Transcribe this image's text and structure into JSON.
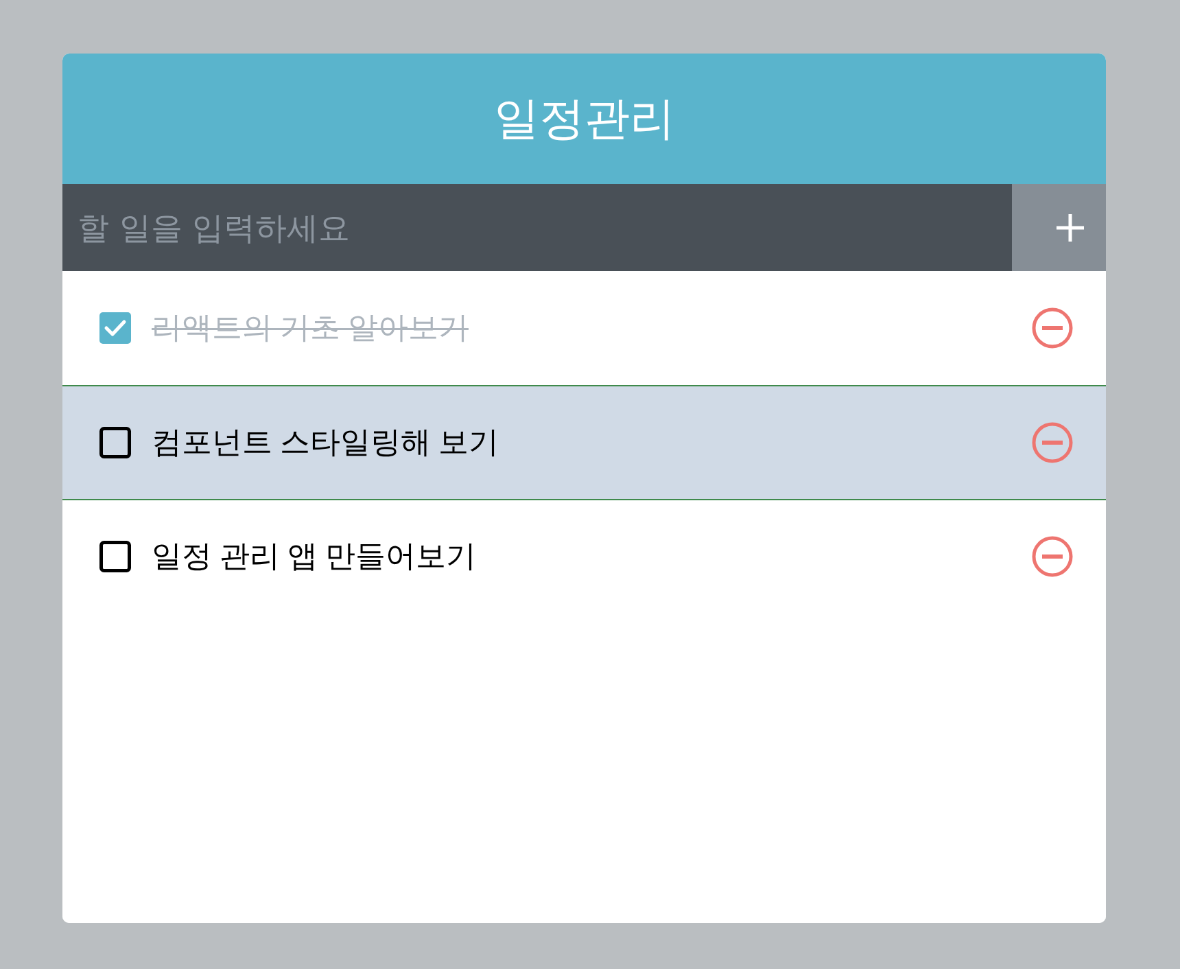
{
  "header": {
    "title": "일정관리"
  },
  "insert_form": {
    "placeholder": "할 일을 입력하세요"
  },
  "items": [
    {
      "text": "리액트의 기초 알아보기",
      "checked": true,
      "selected": false
    },
    {
      "text": "컴포넌트 스타일링해 보기",
      "checked": false,
      "selected": true
    },
    {
      "text": "일정 관리 앱 만들어보기",
      "checked": false,
      "selected": false
    }
  ]
}
